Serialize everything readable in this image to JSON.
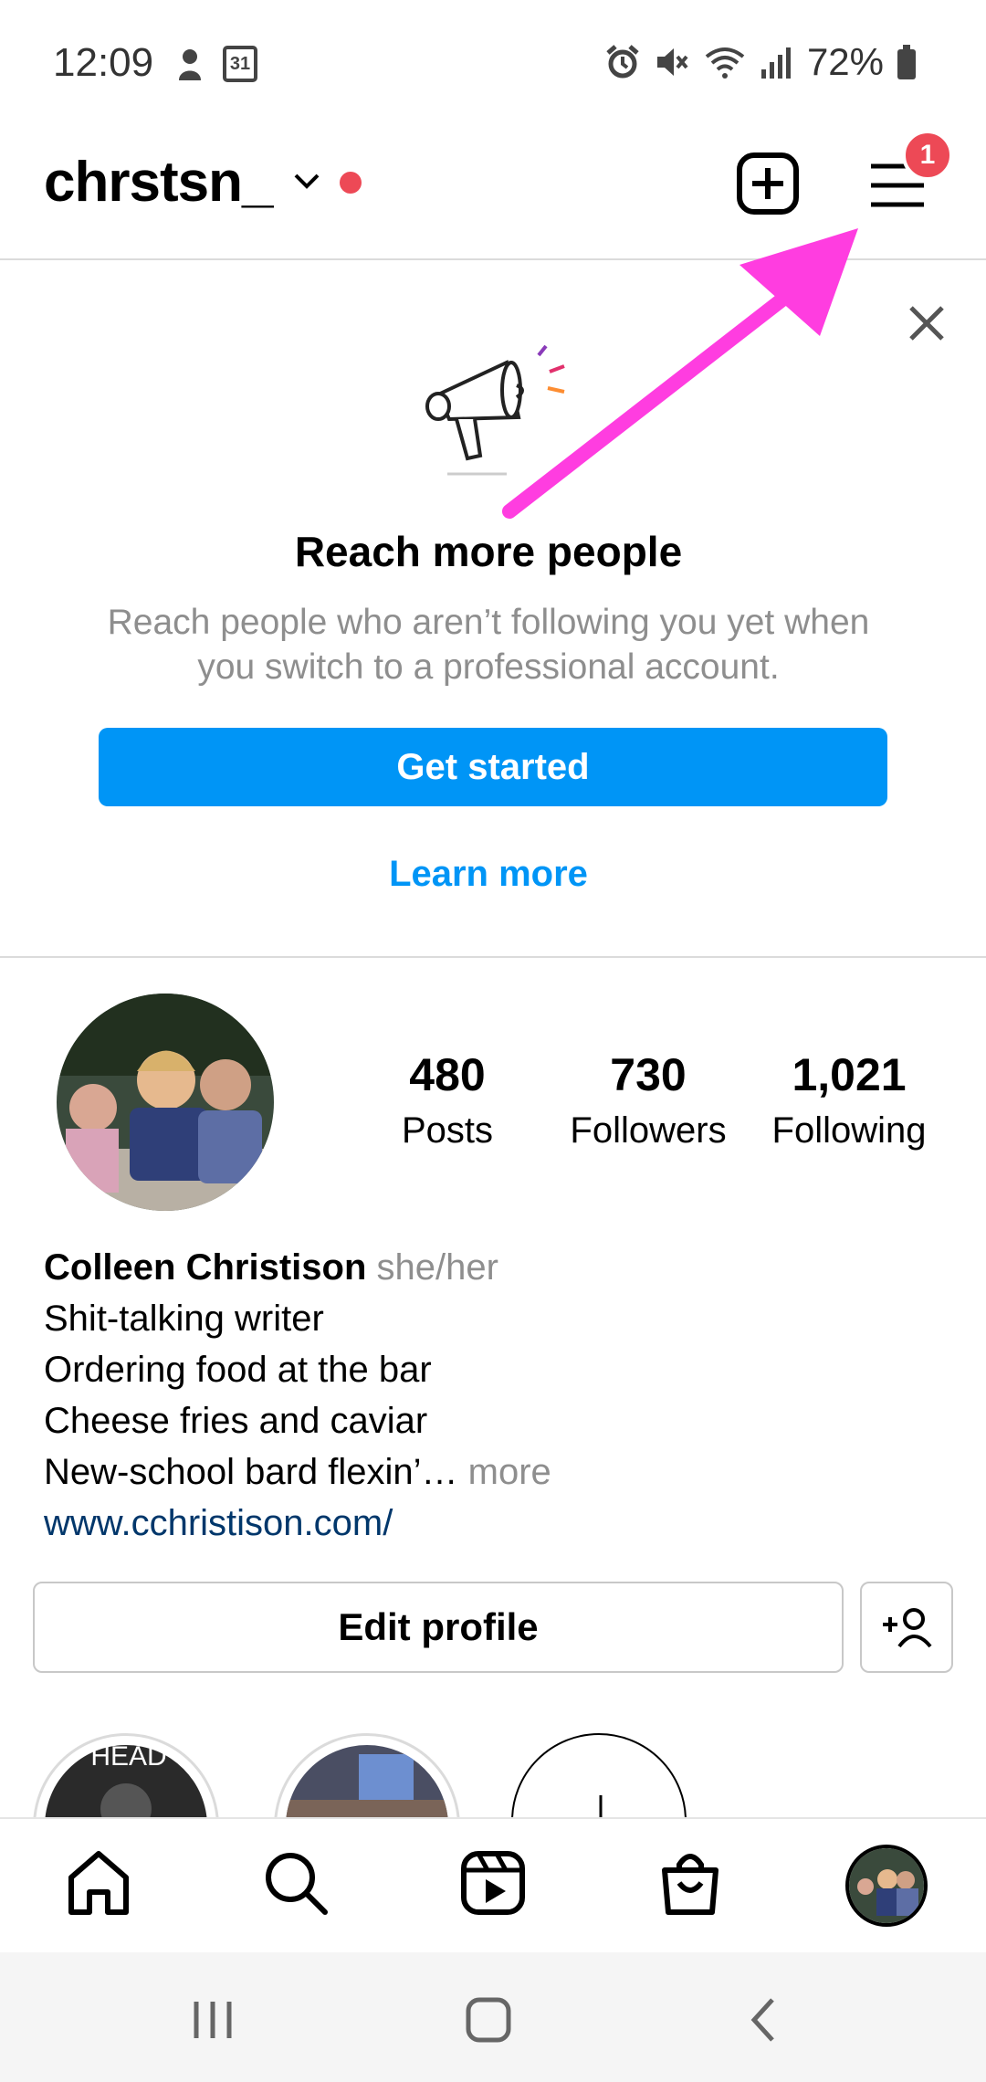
{
  "status_bar": {
    "time": "12:09",
    "calendar_day": "31",
    "battery": "72%"
  },
  "header": {
    "username": "chrstsn_",
    "notification_count": "1"
  },
  "promo": {
    "title": "Reach more people",
    "description": "Reach people who aren’t following you yet when you switch to a professional account.",
    "cta_label": "Get started",
    "secondary_label": "Learn more"
  },
  "profile": {
    "stats": [
      {
        "value": "480",
        "label": "Posts"
      },
      {
        "value": "730",
        "label": "Followers"
      },
      {
        "value": "1,021",
        "label": "Following"
      }
    ],
    "name": "Colleen Christison",
    "pronouns": "she/her",
    "bio_lines": [
      "Shit-talking writer",
      "Ordering food at the bar",
      "Cheese fries and caviar",
      "New-school bard flexin’…"
    ],
    "more_label": " more",
    "website": "www.cchristison.com/",
    "edit_label": "Edit profile"
  },
  "highlights": {
    "first_label": "HEAD"
  },
  "colors": {
    "accent": "#0095f6",
    "badge": "#ed4956",
    "annotation": "#ff3de0"
  },
  "icons": [
    "camera-lock-icon",
    "calendar-icon",
    "alarm-icon",
    "mute-icon",
    "wifi-icon",
    "signal-icon",
    "battery-icon",
    "chevron-down-icon",
    "plus-square-icon",
    "menu-icon",
    "close-icon",
    "megaphone-icon",
    "add-person-icon",
    "home-icon",
    "search-icon",
    "reels-icon",
    "shop-icon"
  ]
}
